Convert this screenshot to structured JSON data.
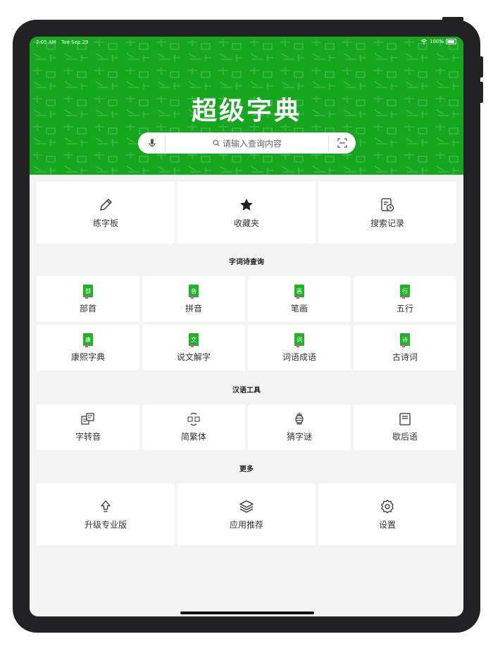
{
  "status": {
    "time": "2:05 AM",
    "date": "Tue Sep 29",
    "battery": "100%"
  },
  "header": {
    "title": "超级字典",
    "search_placeholder": "请输入查询内容"
  },
  "top_cards": [
    {
      "label": "练字板",
      "icon": "pencil-icon"
    },
    {
      "label": "收藏夹",
      "icon": "star-icon"
    },
    {
      "label": "搜索记录",
      "icon": "history-icon"
    }
  ],
  "sections": {
    "lookup": {
      "title": "字词诗查询",
      "items": [
        {
          "label": "部首",
          "badge": "部"
        },
        {
          "label": "拼音",
          "badge": "音"
        },
        {
          "label": "笔画",
          "badge": "画"
        },
        {
          "label": "五行",
          "badge": "行"
        },
        {
          "label": "康熙字典",
          "badge": "康"
        },
        {
          "label": "说文解字",
          "badge": "文"
        },
        {
          "label": "词语成语",
          "badge": "词"
        },
        {
          "label": "古诗词",
          "badge": "诗"
        }
      ]
    },
    "tools": {
      "title": "汉语工具",
      "items": [
        {
          "label": "字转音",
          "icon": "convert-icon"
        },
        {
          "label": "简繁体",
          "icon": "simp-trad-icon"
        },
        {
          "label": "猜字谜",
          "icon": "lantern-icon"
        },
        {
          "label": "歇后语",
          "icon": "book-icon"
        }
      ]
    },
    "more": {
      "title": "更多",
      "items": [
        {
          "label": "升级专业版",
          "icon": "upgrade-icon"
        },
        {
          "label": "应用推荐",
          "icon": "layers-icon"
        },
        {
          "label": "设置",
          "icon": "gear-icon"
        }
      ]
    }
  },
  "colors": {
    "brand_green": "#15a81f",
    "background": "#f4f4f4"
  }
}
